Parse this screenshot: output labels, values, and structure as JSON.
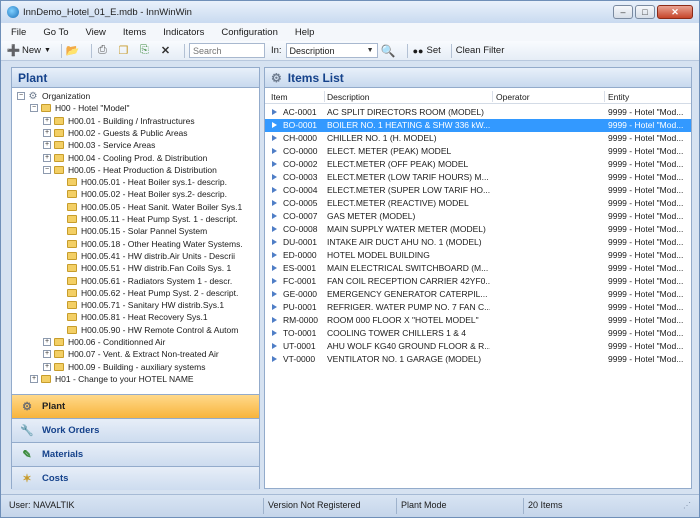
{
  "window": {
    "title": "InnDemo_Hotel_01_E.mdb - InnWinWin"
  },
  "menu": [
    "File",
    "Go To",
    "View",
    "Items",
    "Indicators",
    "Configuration",
    "Help"
  ],
  "toolbar": {
    "new_label": "New",
    "search_placeholder": "Search",
    "in_label": "In:",
    "in_value": "Description",
    "set_label": "Set",
    "clean_filter_label": "Clean Filter"
  },
  "left_panel": {
    "title": "Plant",
    "tree": [
      {
        "label": "Organization",
        "icon": "gear-icon",
        "expander": "-",
        "level": 0
      },
      {
        "label": "H00 - Hotel \"Model\"",
        "icon": "folder-icon",
        "expander": "-",
        "level": 1
      },
      {
        "label": "H00.01 - Building / Infrastructures",
        "icon": "folder-icon",
        "expander": "+",
        "level": 2
      },
      {
        "label": "H00.02 - Guests & Public Areas",
        "icon": "folder-icon",
        "expander": "+",
        "level": 2
      },
      {
        "label": "H00.03 - Service Areas",
        "icon": "folder-icon",
        "expander": "+",
        "level": 2
      },
      {
        "label": "H00.04 - Cooling Prod. & Distribution",
        "icon": "folder-icon",
        "expander": "+",
        "level": 2
      },
      {
        "label": "H00.05 - Heat Production & Distribution",
        "icon": "folder-icon",
        "expander": "-",
        "level": 2
      },
      {
        "label": "H00.05.01 - Heat Boiler sys.1- descrip.",
        "icon": "folder-icon",
        "expander": "",
        "level": 3
      },
      {
        "label": "H00.05.02 - Heat Boiler sys.2- descrip.",
        "icon": "folder-icon",
        "expander": "",
        "level": 3
      },
      {
        "label": "H00.05.05 - Heat Sanit. Water Boiler Sys.1",
        "icon": "folder-icon",
        "expander": "",
        "level": 3
      },
      {
        "label": "H00.05.11 - Heat Pump Syst. 1 - descript.",
        "icon": "folder-icon",
        "expander": "",
        "level": 3
      },
      {
        "label": "H00.05.15 - Solar Pannel System",
        "icon": "folder-icon",
        "expander": "",
        "level": 3
      },
      {
        "label": "H00.05.18 - Other Heating Water Systems.",
        "icon": "folder-icon",
        "expander": "",
        "level": 3
      },
      {
        "label": "H00.05.41 - HW distrib.Air Units - Descrii",
        "icon": "folder-icon",
        "expander": "",
        "level": 3
      },
      {
        "label": "H00.05.51 - HW distrib.Fan Coils Sys. 1",
        "icon": "folder-icon",
        "expander": "",
        "level": 3
      },
      {
        "label": "H00.05.61 - Radiators System 1 - descr.",
        "icon": "folder-icon",
        "expander": "",
        "level": 3
      },
      {
        "label": "H00.05.62 - Heat Pump Syst. 2 - descript.",
        "icon": "folder-icon",
        "expander": "",
        "level": 3
      },
      {
        "label": "H00.05.71 - Sanitary HW distrib.Sys.1",
        "icon": "folder-icon",
        "expander": "",
        "level": 3
      },
      {
        "label": "H00.05.81 - Heat Recovery Sys.1",
        "icon": "folder-icon",
        "expander": "",
        "level": 3
      },
      {
        "label": "H00.05.90 - HW Remote Control & Autom",
        "icon": "folder-icon",
        "expander": "",
        "level": 3
      },
      {
        "label": "H00.06 - Conditionned Air",
        "icon": "folder-icon",
        "expander": "+",
        "level": 2
      },
      {
        "label": "H00.07 - Vent. & Extract Non-treated Air",
        "icon": "folder-icon",
        "expander": "+",
        "level": 2
      },
      {
        "label": "H00.09 - Building - auxiliary systems",
        "icon": "folder-icon",
        "expander": "+",
        "level": 2
      },
      {
        "label": "H01 - Change to your HOTEL NAME",
        "icon": "folder-icon",
        "expander": "+",
        "level": 1
      }
    ],
    "nav": [
      {
        "label": "Plant",
        "icon": "gear-icon",
        "active": true
      },
      {
        "label": "Work Orders",
        "icon": "wrench-icon",
        "active": false
      },
      {
        "label": "Materials",
        "icon": "materials-icon",
        "active": false
      },
      {
        "label": "Costs",
        "icon": "costs-icon",
        "active": false
      }
    ]
  },
  "right_panel": {
    "title": "Items List",
    "columns": [
      "Item",
      "Description",
      "Operator",
      "Entity"
    ],
    "rows": [
      {
        "item": "AC-0001",
        "description": "AC SPLIT DIRECTORS ROOM (MODEL)",
        "operator": "",
        "entity": "9999 - Hotel \"Mod..."
      },
      {
        "item": "BO-0001",
        "description": "BOILER NO. 1 HEATING & SHW 336 kW...",
        "operator": "",
        "entity": "9999 - Hotel \"Mod...",
        "selected": true
      },
      {
        "item": "CH-0000",
        "description": "CHILLER NO. 1 (H. MODEL)",
        "operator": "",
        "entity": "9999 - Hotel \"Mod..."
      },
      {
        "item": "CO-0000",
        "description": "ELECT. METER (PEAK) MODEL",
        "operator": "",
        "entity": "9999 - Hotel \"Mod..."
      },
      {
        "item": "CO-0002",
        "description": "ELECT.METER (OFF PEAK) MODEL",
        "operator": "",
        "entity": "9999 - Hotel \"Mod..."
      },
      {
        "item": "CO-0003",
        "description": "ELECT.METER (LOW TARIF HOURS) M...",
        "operator": "",
        "entity": "9999 - Hotel \"Mod..."
      },
      {
        "item": "CO-0004",
        "description": "ELECT.METER (SUPER LOW TARIF HO...",
        "operator": "",
        "entity": "9999 - Hotel \"Mod..."
      },
      {
        "item": "CO-0005",
        "description": "ELECT.METER (REACTIVE) MODEL",
        "operator": "",
        "entity": "9999 - Hotel \"Mod..."
      },
      {
        "item": "CO-0007",
        "description": "GAS METER (MODEL)",
        "operator": "",
        "entity": "9999 - Hotel \"Mod..."
      },
      {
        "item": "CO-0008",
        "description": "MAIN SUPPLY WATER METER (MODEL)",
        "operator": "",
        "entity": "9999 - Hotel \"Mod..."
      },
      {
        "item": "DU-0001",
        "description": "INTAKE AIR DUCT AHU NO. 1 (MODEL)",
        "operator": "",
        "entity": "9999 - Hotel \"Mod..."
      },
      {
        "item": "ED-0000",
        "description": "HOTEL MODEL BUILDING",
        "operator": "",
        "entity": "9999 - Hotel \"Mod..."
      },
      {
        "item": "ES-0001",
        "description": "MAIN ELECTRICAL SWITCHBOARD (M...",
        "operator": "",
        "entity": "9999 - Hotel \"Mod..."
      },
      {
        "item": "FC-0001",
        "description": "FAN COIL RECEPTION CARRIER 42YF0...",
        "operator": "",
        "entity": "9999 - Hotel \"Mod..."
      },
      {
        "item": "GE-0000",
        "description": "EMERGENCY GENERATOR CATERPIL...",
        "operator": "",
        "entity": "9999 - Hotel \"Mod..."
      },
      {
        "item": "PU-0001",
        "description": "REFRIGER. WATER PUMP NO. 7 FAN C...",
        "operator": "",
        "entity": "9999 - Hotel \"Mod..."
      },
      {
        "item": "RM-0000",
        "description": "ROOM 000 FLOOR X \"HOTEL MODEL\"",
        "operator": "",
        "entity": "9999 - Hotel \"Mod..."
      },
      {
        "item": "TO-0001",
        "description": "COOLING TOWER CHILLERS 1 & 4",
        "operator": "",
        "entity": "9999 - Hotel \"Mod..."
      },
      {
        "item": "UT-0001",
        "description": "AHU WOLF KG40 GROUND FLOOR & R...",
        "operator": "",
        "entity": "9999 - Hotel \"Mod..."
      },
      {
        "item": "VT-0000",
        "description": "VENTILATOR NO. 1 GARAGE (MODEL)",
        "operator": "",
        "entity": "9999 - Hotel \"Mod..."
      }
    ]
  },
  "status": {
    "user": "User: NAVALTIK",
    "registration": "Version Not Registered",
    "mode": "Plant Mode",
    "count": "20 Items"
  }
}
